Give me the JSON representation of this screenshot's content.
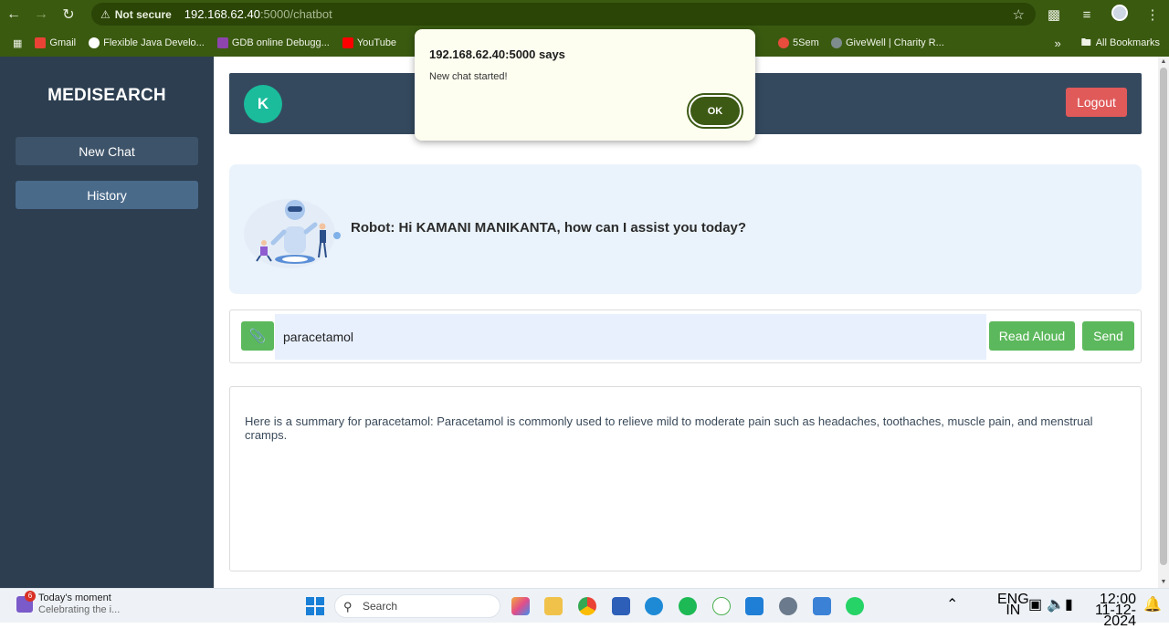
{
  "browser": {
    "security_label": "Not secure",
    "url_host": "192.168.62.40",
    "url_path": ":5000/chatbot",
    "bookmarks": [
      "Gmail",
      "Flexible Java Develo...",
      "GDB online Debugg...",
      "YouTube",
      "5Sem",
      "GiveWell | Charity R..."
    ],
    "all_bookmarks": "All Bookmarks"
  },
  "sidebar": {
    "brand": "MEDISEARCH",
    "new_chat": "New Chat",
    "history": "History"
  },
  "header": {
    "avatar_initial": "K",
    "logout": "Logout"
  },
  "greeting": {
    "text": "Robot: Hi KAMANI MANIKANTA, how can I assist you today?"
  },
  "input": {
    "value": "paracetamol",
    "read_aloud": "Read Aloud",
    "send": "Send"
  },
  "response": {
    "text": "Here is a summary for paracetamol: Paracetamol is commonly used to relieve mild to moderate pain such as headaches, toothaches, muscle pain, and menstrual cramps."
  },
  "dialog": {
    "title": "192.168.62.40:5000 says",
    "message": "New chat started!",
    "ok": "OK"
  },
  "taskbar": {
    "news_title": "Today's moment",
    "news_sub": "Celebrating the i...",
    "news_badge": "6",
    "search": "Search",
    "lang_top": "ENG",
    "lang_bottom": "IN",
    "time": "12:00",
    "date": "11-12-2024"
  },
  "colors": {
    "sidebar": "#2c3e50",
    "header": "#34495e",
    "accent_green": "#5cb85c",
    "logout_red": "#e05a5a",
    "avatar": "#1abc9c",
    "chrome": "#3a5a10"
  }
}
